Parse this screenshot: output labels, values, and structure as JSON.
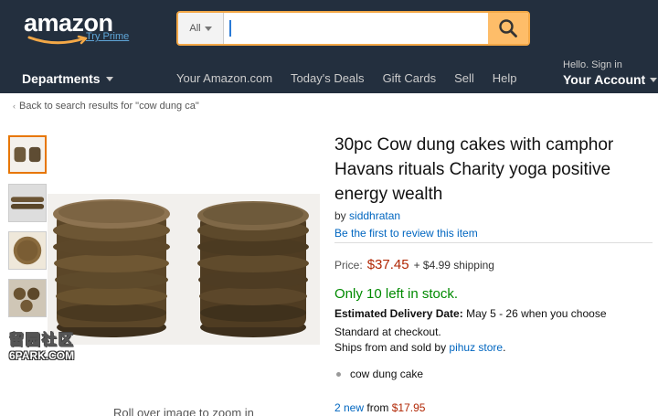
{
  "header": {
    "logo_text": "amazon",
    "logo_prime": "Try Prime",
    "search_category": "All",
    "search_value": "",
    "departments_label": "Departments",
    "nav_links": [
      "Your Amazon.com",
      "Today's Deals",
      "Gift Cards",
      "Sell",
      "Help"
    ],
    "hello_text": "Hello. Sign in",
    "account_label": "Your Account"
  },
  "breadcrumb": {
    "text": "Back to search results for \"cow dung ca\""
  },
  "thumbnails": [
    {
      "name": "stacks-side"
    },
    {
      "name": "cakes-rows"
    },
    {
      "name": "single-cake"
    },
    {
      "name": "cakes-tray"
    }
  ],
  "gallery": {
    "rollover_text": "Roll over image to zoom in",
    "watermark_top": "留园社区",
    "watermark_bottom": "6PARK.COM"
  },
  "product": {
    "title": "30pc Cow dung cakes with camphor Havans rituals Charity yoga positive energy wealth",
    "by_prefix": "by",
    "seller": "siddhratan",
    "review_link": "Be the first to review this item",
    "price_label": "Price:",
    "price": "$37.45",
    "shipping": "+ $4.99 shipping",
    "stock": "Only 10 left in stock.",
    "delivery_label": "Estimated Delivery Date:",
    "delivery_text": "May 5 - 26 when you choose Standard at checkout.",
    "sold_by_prefix": "Ships from and sold by",
    "sold_by_store": "pihuz store",
    "sold_by_suffix": ".",
    "bullets": [
      "cow dung cake"
    ],
    "offers_link": "2 new",
    "offers_from": "from",
    "offers_price": "$17.95"
  },
  "colors": {
    "header_bg": "#232f3e",
    "search_button": "#febd69",
    "price": "#b12704",
    "stock": "#008a00",
    "link": "#0066c0"
  }
}
